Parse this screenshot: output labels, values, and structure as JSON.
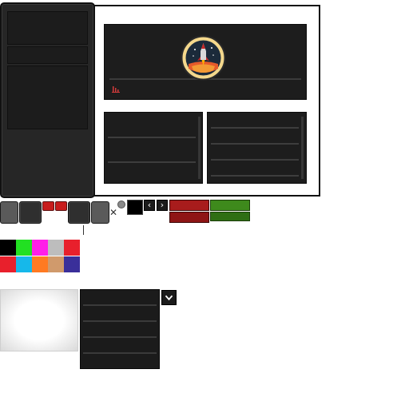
{
  "icons": {
    "chart": "chart-icon",
    "rocket": "rocket-icon",
    "prev": "chevron-left-icon",
    "next": "chevron-right-icon",
    "dropdown": "chevron-down-icon",
    "close": "close-icon"
  },
  "nav": {
    "prev_glyph": "‹",
    "next_glyph": "›",
    "close_glyph": "✕"
  },
  "palette": {
    "row1": [
      "#000000",
      "#22e022",
      "#ff1ee8",
      "#bdbdbd",
      "#e8202c"
    ],
    "row2": [
      "#e8202c",
      "#16b8ea",
      "#ff7a22",
      "#d09a6c",
      "#3a2f9a"
    ]
  },
  "colors": {
    "accent_red": "#c81d1d",
    "accent_green": "#3e8a1c",
    "dark_panel": "#1d1d1d"
  }
}
